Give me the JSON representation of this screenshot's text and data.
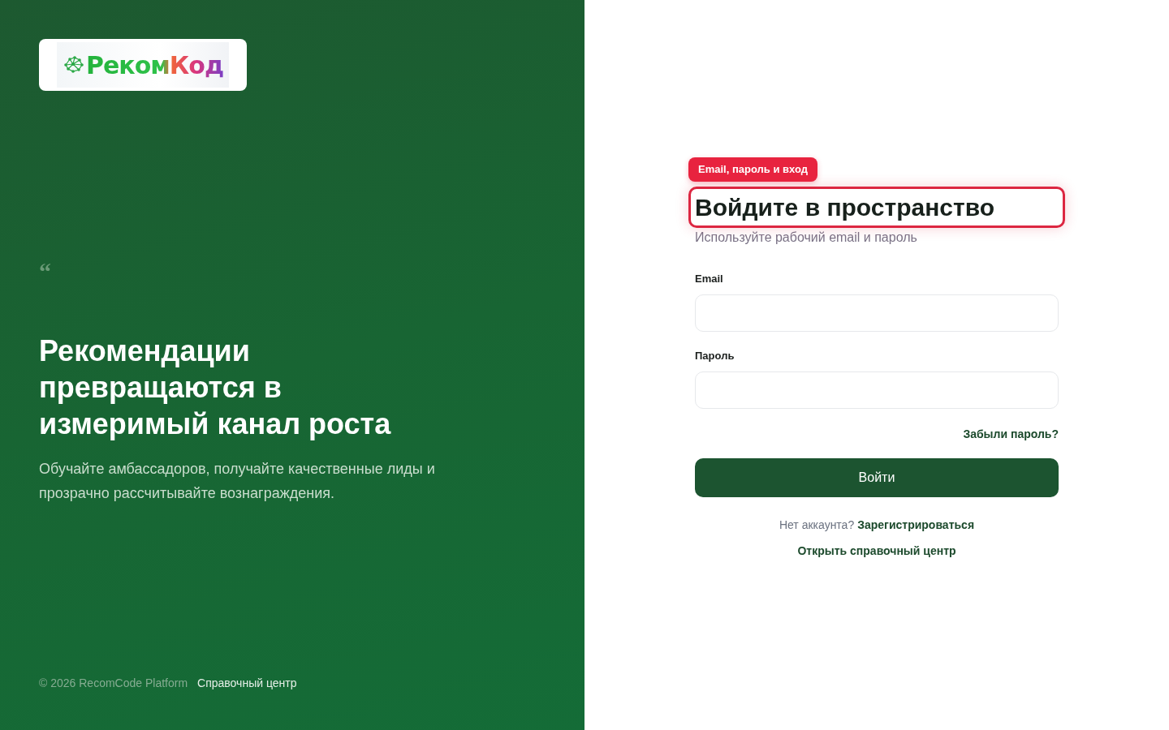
{
  "brand_panel": {
    "logo": {
      "text": "РекомКод"
    },
    "quote_mark": "“",
    "headline": "Рекомендации превращаются в измеримый канал роста",
    "description": "Обучайте амбассадоров, получайте качественные лиды и прозрачно рассчитывайте вознаграждения.",
    "footer": {
      "copyright": "© 2026 RecomCode Platform",
      "link": "Справочный центр"
    }
  },
  "login_form": {
    "callout": {
      "label": "Email, пароль и вход"
    },
    "title": {
      "text": "Войдите в пространство",
      "highlighted": true
    },
    "subtitle": "Используйте рабочий email и пароль",
    "fields": [
      {
        "label": "Email"
      },
      {
        "label": "Пароль"
      }
    ],
    "forgot_link": "Забыли пароль?",
    "submit_button": "Войти",
    "signup": {
      "prompt": "Нет аккаунта?",
      "link": "Зарегистрироваться"
    },
    "help_link": "Открыть справочный центр"
  }
}
